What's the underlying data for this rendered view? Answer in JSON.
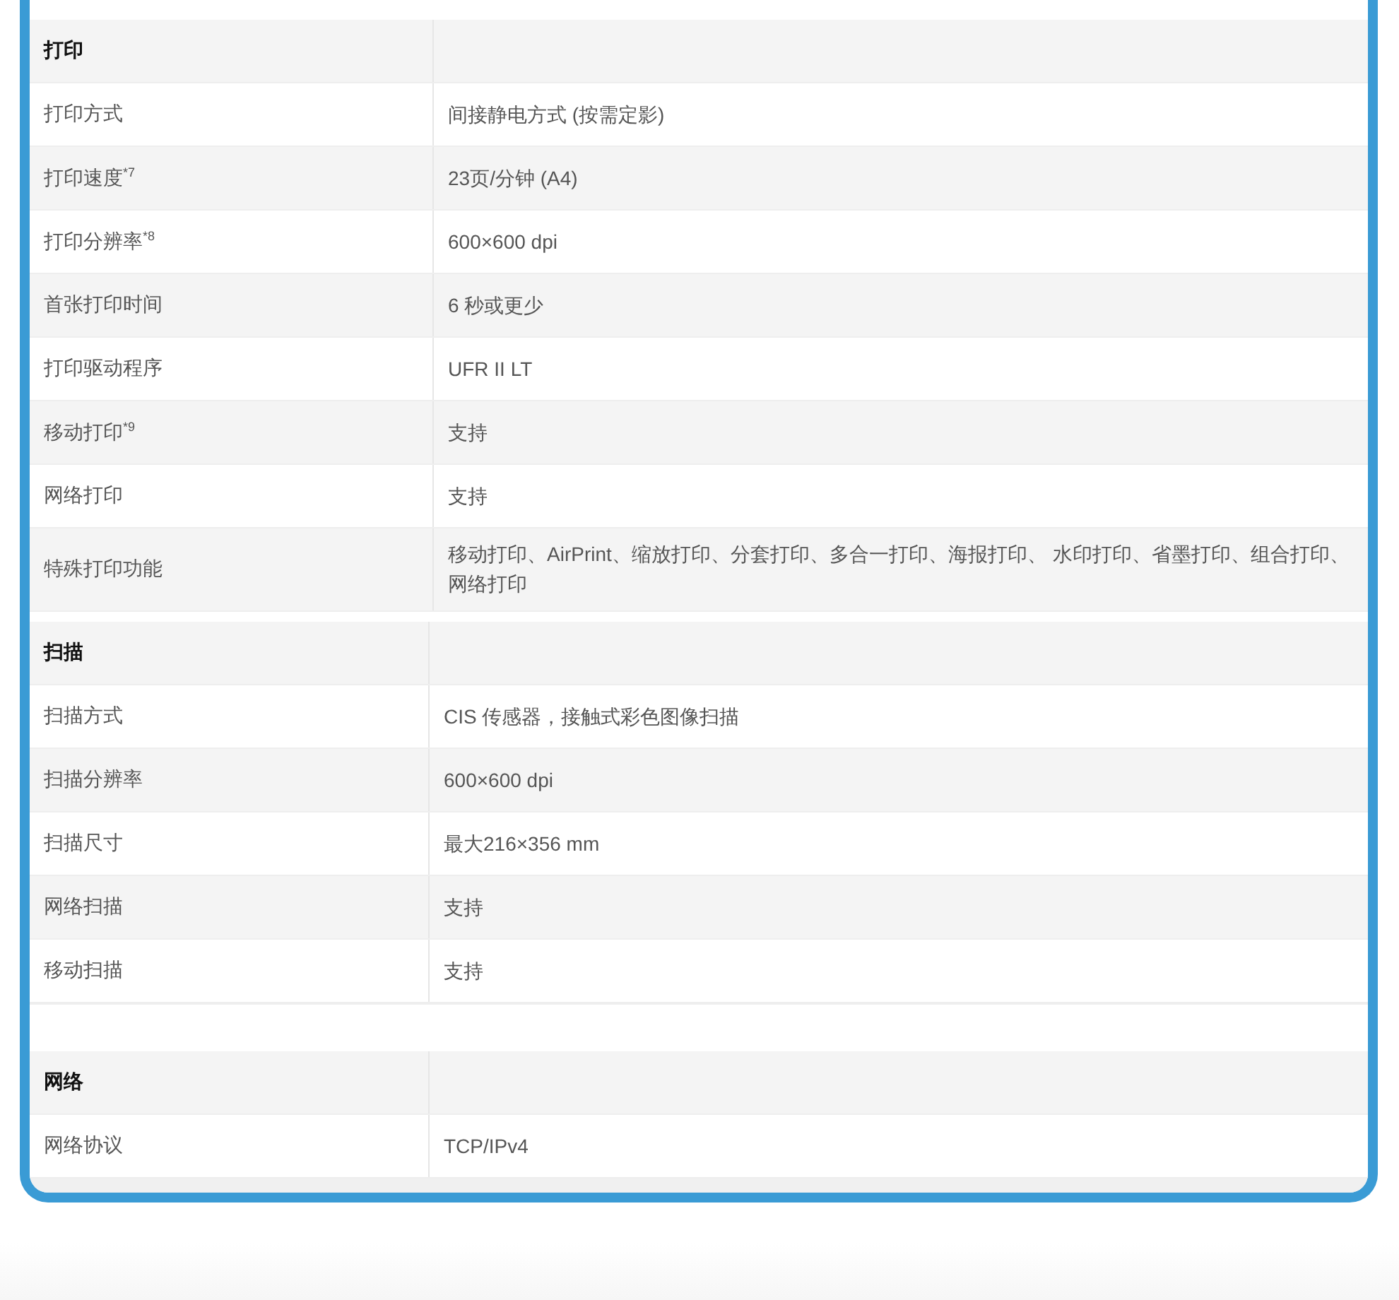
{
  "sections": [
    {
      "title": "打印",
      "rows": [
        {
          "label": "打印方式",
          "value": "间接静电方式 (按需定影)"
        },
        {
          "label": "打印速度$^{*7}$",
          "value": "23页/分钟 (A4)"
        },
        {
          "label": "打印分辨率$^{*8}$",
          "value": "600×600 dpi"
        },
        {
          "label": "首张打印时间",
          "value": "6 秒或更少"
        },
        {
          "label": "打印驱动程序",
          "value": "UFR II LT"
        },
        {
          "label": "移动打印$^{*9}$",
          "value": "支持"
        },
        {
          "label": "网络打印",
          "value": "支持"
        },
        {
          "label": "特殊打印功能",
          "value": "移动打印、AirPrint、缩放打印、分套打印、多合一打印、海报打印、 水印打印、省墨打印、组合打印、网络打印"
        }
      ]
    },
    {
      "title": "扫描",
      "rows": [
        {
          "label": "扫描方式",
          "value": "CIS 传感器，接触式彩色图像扫描"
        },
        {
          "label": "扫描分辨率",
          "value": "600×600 dpi"
        },
        {
          "label": "扫描尺寸",
          "value": "最大216×356 mm"
        },
        {
          "label": "网络扫描",
          "value": "支持"
        },
        {
          "label": "移动扫描",
          "value": "支持"
        }
      ]
    },
    {
      "title": "网络",
      "rows": [
        {
          "label": "网络协议",
          "value": "TCP/IPv4"
        }
      ]
    }
  ]
}
